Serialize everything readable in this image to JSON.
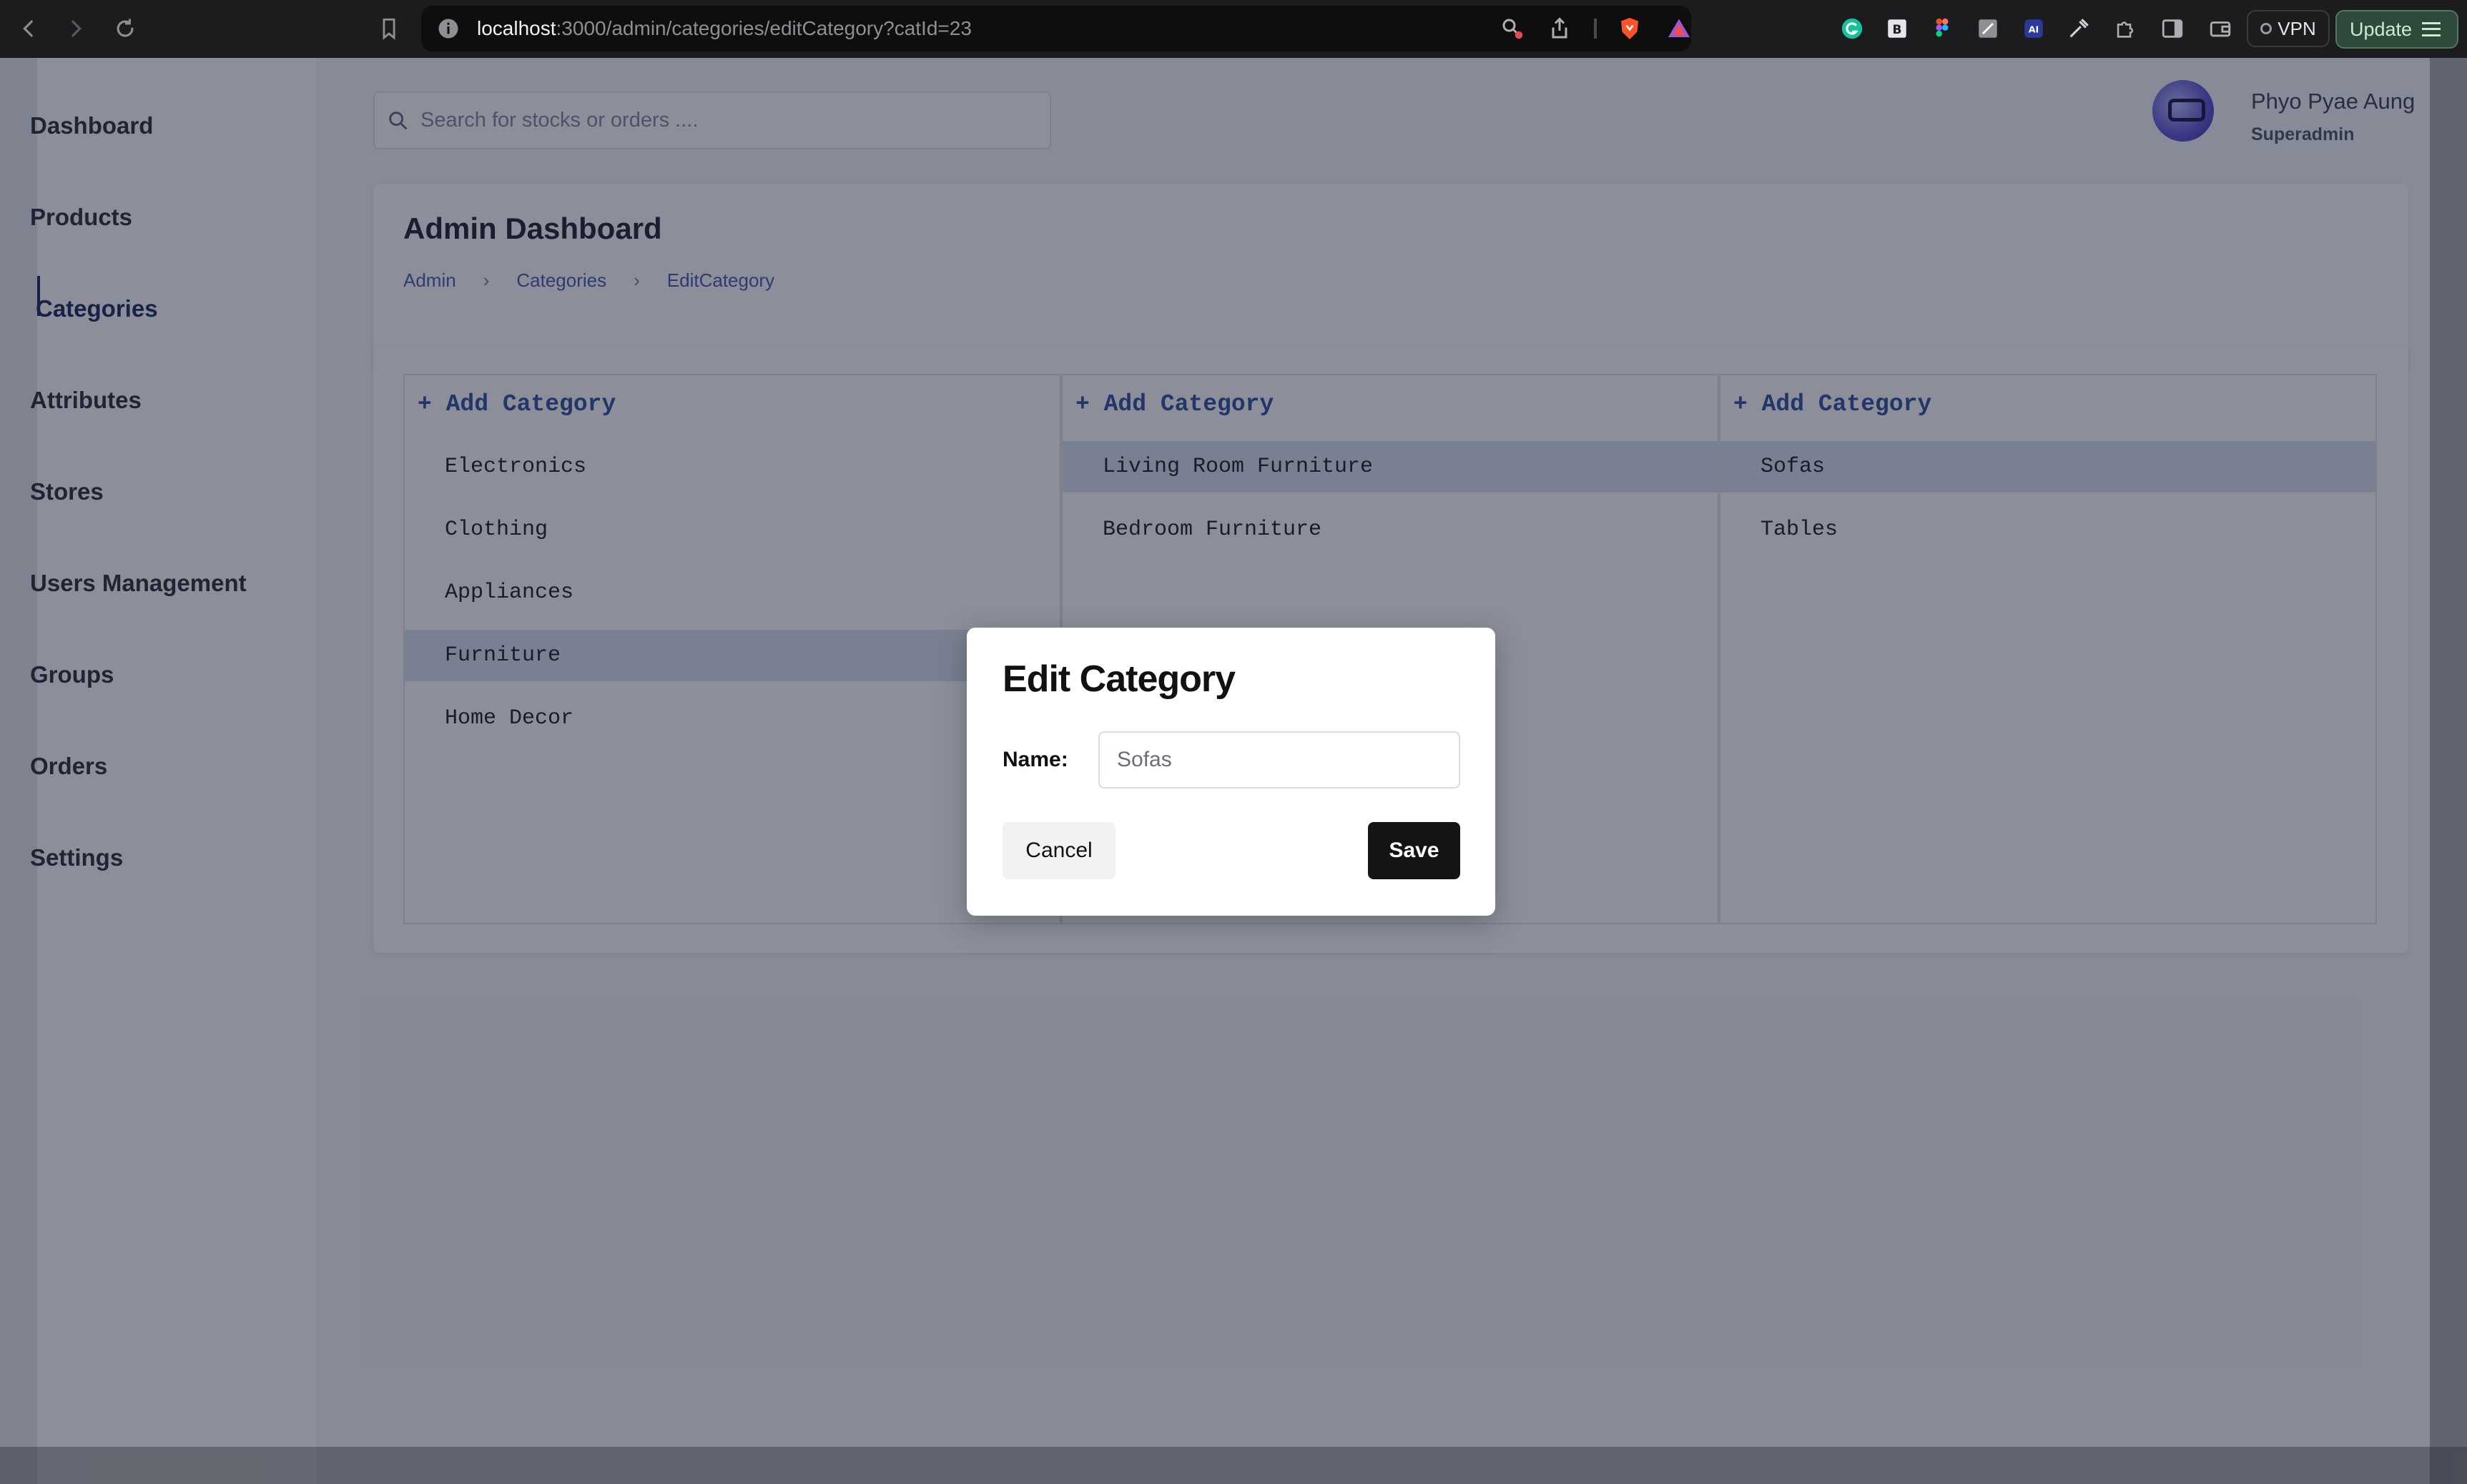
{
  "browser": {
    "url_host": "localhost",
    "url_path": ":3000/admin/categories/editCategory?catId=23",
    "vpn_label": "VPN",
    "update_label": "Update"
  },
  "sidebar": {
    "items": [
      {
        "label": "Dashboard",
        "active": false
      },
      {
        "label": "Products",
        "active": false
      },
      {
        "label": "Categories",
        "active": true
      },
      {
        "label": "Attributes",
        "active": false
      },
      {
        "label": "Stores",
        "active": false
      },
      {
        "label": "Users Management",
        "active": false
      },
      {
        "label": "Groups",
        "active": false
      },
      {
        "label": "Orders",
        "active": false
      },
      {
        "label": "Settings",
        "active": false
      }
    ]
  },
  "search": {
    "placeholder": "Search for stocks or orders ...."
  },
  "user": {
    "name": "Phyo Pyae Aung",
    "role": "Superadmin"
  },
  "header": {
    "title": "Admin Dashboard",
    "breadcrumb": [
      "Admin",
      "Categories",
      "EditCategory"
    ],
    "separator": "›"
  },
  "columns": [
    {
      "add_label": "+ Add Category",
      "items": [
        "Electronics",
        "Clothing",
        "Appliances",
        "Furniture",
        "Home Decor"
      ],
      "selected": "Furniture"
    },
    {
      "add_label": "+ Add Category",
      "items": [
        "Living Room Furniture",
        "Bedroom Furniture"
      ],
      "selected": "Living Room Furniture"
    },
    {
      "add_label": "+ Add Category",
      "items": [
        "Sofas",
        "Tables"
      ],
      "selected": "Sofas"
    }
  ],
  "modal": {
    "title": "Edit Category",
    "name_label": "Name:",
    "name_value": "Sofas",
    "cancel_label": "Cancel",
    "save_label": "Save"
  },
  "colors": {
    "accent": "#2b3a67",
    "link": "#5068b8",
    "save_button": "#141414",
    "overlay": "#00061e"
  }
}
